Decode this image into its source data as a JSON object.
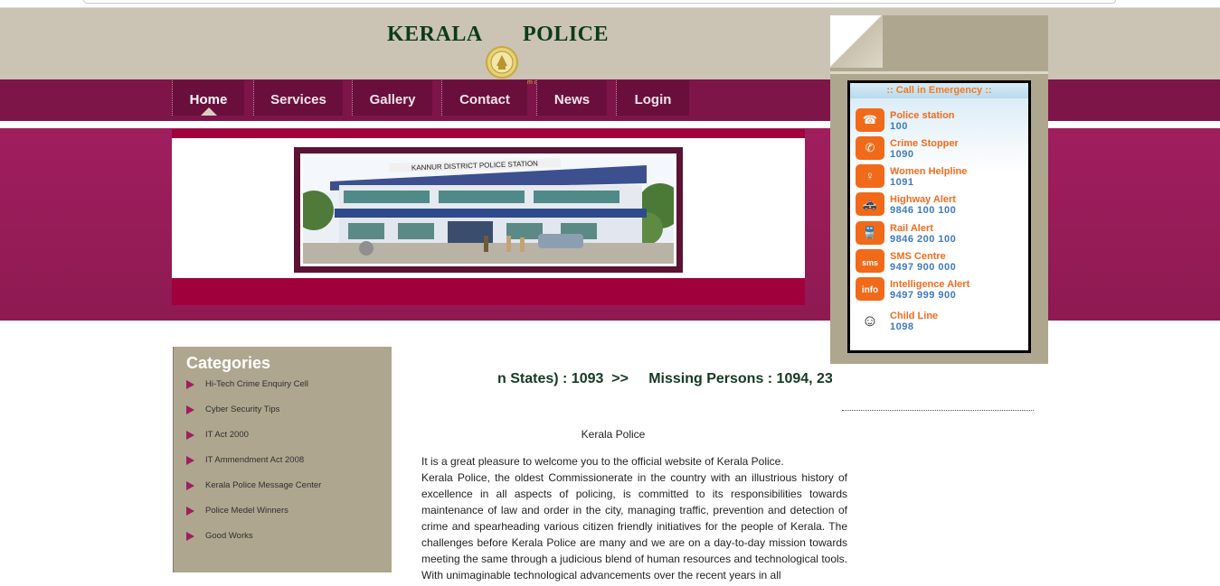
{
  "header": {
    "brand_left": "KERALA",
    "brand_right": "POLICE",
    "nav_small": "m ce"
  },
  "nav": {
    "items": [
      {
        "label": "Home",
        "active": true
      },
      {
        "label": "Services"
      },
      {
        "label": "Gallery"
      },
      {
        "label": "Contact"
      },
      {
        "label": "News"
      },
      {
        "label": "Login"
      }
    ]
  },
  "banner": {
    "photo_caption": "KANNUR DISTRICT POLICE STATION"
  },
  "emergency": {
    "title": ":: Call in Emergency ::",
    "items": [
      {
        "label": "Police station",
        "number": "100",
        "icon": "telephone-icon"
      },
      {
        "label": "Crime Stopper",
        "number": "1090",
        "icon": "handset-icon"
      },
      {
        "label": "Women Helpline",
        "number": "1091",
        "icon": "woman-helpline-icon"
      },
      {
        "label": "Highway Alert",
        "number": "9846 100 100",
        "icon": "police-car-icon"
      },
      {
        "label": "Rail Alert",
        "number": "9846 200 100",
        "icon": "train-icon"
      },
      {
        "label": "SMS Centre",
        "number": "9497 900 000",
        "icon": "sms-icon"
      },
      {
        "label": "Intelligence Alert",
        "number": "9497 999 900",
        "icon": "info-icon"
      },
      {
        "label": "Child Line",
        "number": "1098",
        "icon": "child-icon"
      }
    ],
    "icon_texts": {
      "sms": "sms",
      "info": "info"
    }
  },
  "categories": {
    "title": "Categories",
    "items": [
      "Hi-Tech Crime Enquiry Cell",
      "Cyber Security Tips",
      "IT Act 2000",
      "IT Ammendment Act 2008",
      "Kerala Police Message Center",
      "Police Medel Winners",
      "Good Works"
    ]
  },
  "ticker": {
    "text": "n States) : 1093  >>     Missing Persons : 1094, 23"
  },
  "content": {
    "title": "Kerala  Police",
    "intro": "It is a great pleasure to welcome you to the official website of Kerala Police.",
    "body": "Kerala Police, the oldest Commissionerate in the country with an illustrious history of excellence in all aspects of policing, is committed to its responsibilities towards maintenance of law and order in the city, managing traffic, prevention and detection of crime and spearheading various citizen friendly initiatives for the people of Kerala. The challenges before Kerala Police are many and we are on a day-to-day mission towards meeting the same through a judicious blend of human resources and technological tools. With unimaginable technological advancements over the recent years in all"
  },
  "colors": {
    "header_bg": "#cbc4b4",
    "nav_bg": "#7e1548",
    "banner_pink": "#a01e5e",
    "panel_tan": "#aea68f",
    "emergency_orange": "#f26b1f",
    "emergency_blue": "#3d79c2",
    "brand_green": "#0d3a1c"
  }
}
